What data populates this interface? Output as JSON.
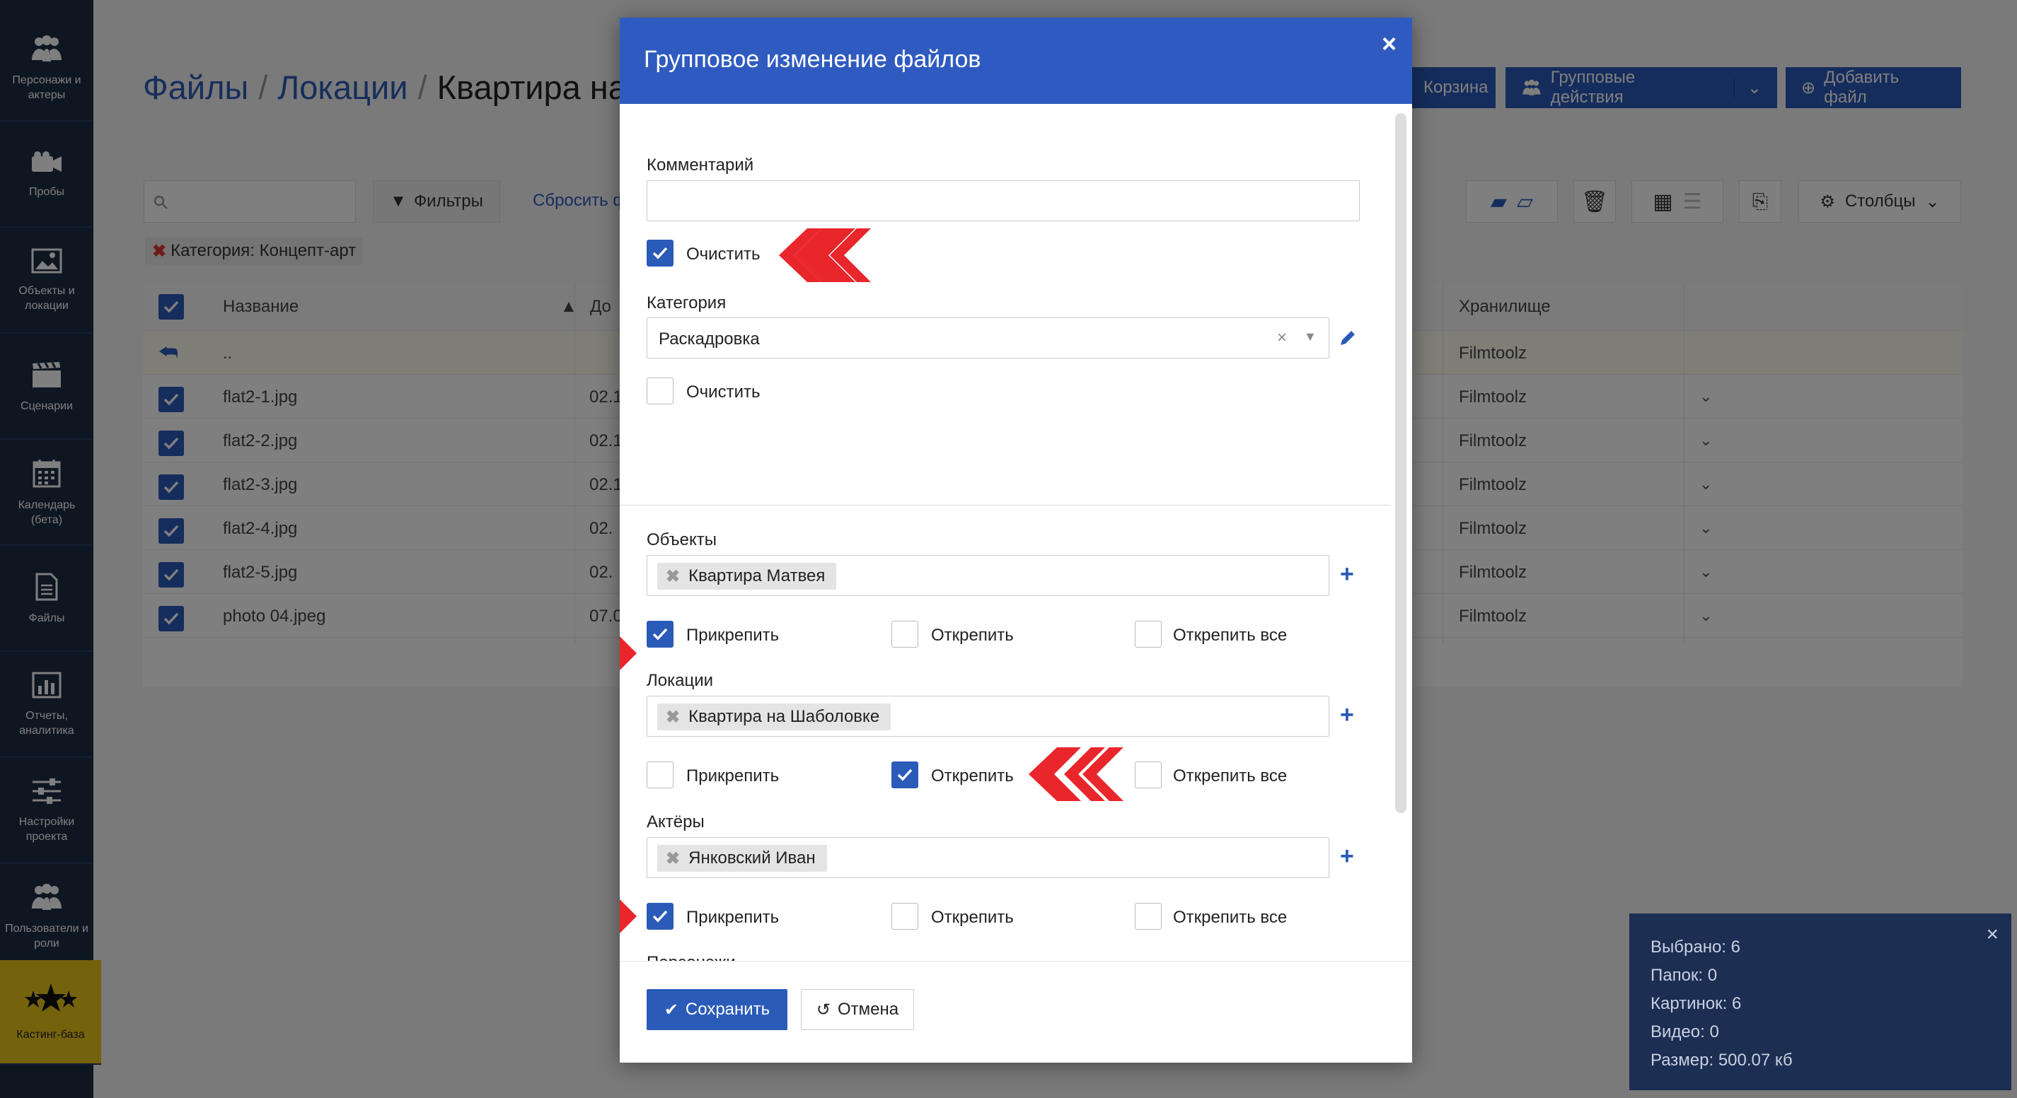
{
  "sidebar": {
    "items": [
      {
        "label": "Персонажи и актеры",
        "icon": "people-icon"
      },
      {
        "label": "Пробы",
        "icon": "camera-icon"
      },
      {
        "label": "Объекты и локации",
        "icon": "image-icon"
      },
      {
        "label": "Сценарии",
        "icon": "clapper-icon"
      },
      {
        "label": "Календарь (бета)",
        "icon": "calendar-icon"
      },
      {
        "label": "Файлы",
        "icon": "file-icon"
      },
      {
        "label": "Отчеты, аналитика",
        "icon": "chart-icon"
      },
      {
        "label": "Настройки проекта",
        "icon": "sliders-icon"
      },
      {
        "label": "Пользователи и роли",
        "icon": "users-icon"
      },
      {
        "label": "Кастинг-база",
        "icon": "stars-icon"
      }
    ]
  },
  "page": {
    "breadcrumb": [
      "Файлы",
      "Локации",
      "Квартира на"
    ],
    "trash_label": "Корзина",
    "group_actions_label": "Групповые действия",
    "add_file_label": "Добавить файл",
    "filters_label": "Фильтры",
    "reset_label": "Сбросить ф",
    "columns_label": "Столбцы",
    "filter_tag": "Категория: Концепт-арт",
    "grid": {
      "col_name": "Название",
      "col_date": "До",
      "col_storage": "Хранилище",
      "parent_row": "..",
      "parent_storage": "Filmtoolz",
      "rows": [
        {
          "name": "flat2-1.jpg",
          "date": "02.1",
          "storage": "Filmtoolz"
        },
        {
          "name": "flat2-2.jpg",
          "date": "02.1",
          "storage": "Filmtoolz"
        },
        {
          "name": "flat2-3.jpg",
          "date": "02.1",
          "storage": "Filmtoolz"
        },
        {
          "name": "flat2-4.jpg",
          "date": "02.",
          "storage": "Filmtoolz"
        },
        {
          "name": "flat2-5.jpg",
          "date": "02.",
          "storage": "Filmtoolz"
        },
        {
          "name": "photo 04.jpeg",
          "date": "07.0",
          "storage": "Filmtoolz"
        }
      ]
    }
  },
  "selection_panel": {
    "selected": "Выбрано: 6",
    "folders": "Папок: 0",
    "pictures": "Картинок: 6",
    "videos": "Видео: 0",
    "size": "Размер: 500.07 кб"
  },
  "modal": {
    "title": "Групповое изменение файлов",
    "close": "×",
    "comment_label": "Комментарий",
    "comment_value": "",
    "comment_clear_label": "Очистить",
    "comment_clear_checked": true,
    "category_label": "Категория",
    "category_value": "Раскадровка",
    "category_clear_label": "Очистить",
    "category_clear_checked": false,
    "attach_label": "Прикрепить",
    "detach_label": "Открепить",
    "detach_all_label": "Открепить все",
    "sections": [
      {
        "label": "Объекты",
        "tag": "Квартира Матвея",
        "attach": true,
        "detach": false,
        "detach_all": false
      },
      {
        "label": "Локации",
        "tag": "Квартира на Шаболовке",
        "attach": false,
        "detach": true,
        "detach_all": false
      },
      {
        "label": "Актёры",
        "tag": "Янковский Иван",
        "attach": true,
        "detach": false,
        "detach_all": false
      },
      {
        "label": "Персонажи",
        "tag": "",
        "attach": false,
        "detach": false,
        "detach_all": false
      }
    ],
    "save_label": "Сохранить",
    "cancel_label": "Отмена"
  },
  "colors": {
    "primary": "#2b5bb8",
    "header": "#2f5bc0",
    "sidebar": "#1d2c45",
    "accent_arrow": "#e8262b",
    "casting": "#e8c51a"
  }
}
